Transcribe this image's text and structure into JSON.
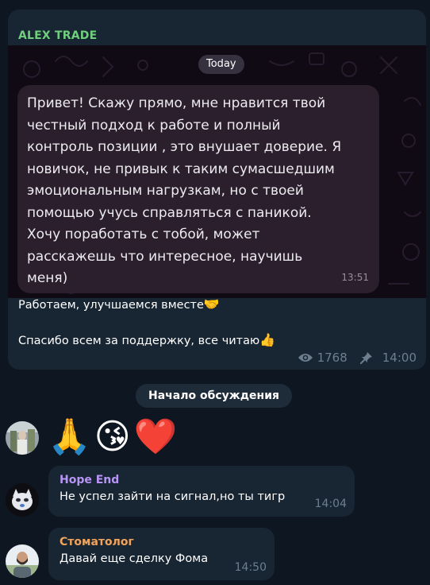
{
  "channel_post": {
    "author": "ALEX TRADE",
    "author_color": "#6fcf7c",
    "date_label": "Today",
    "quoted_message": {
      "text": "Привет! Скажу прямо, мне нравится твой\nчестный подход к работе и полный\nконтроль позиции , это внушает доверие. Я\nновичок, не привык к таким сумасшедшим\nэмоциональным нагрузкам, но с твоей\nпомощью учусь справляться с паникой.\nХочу поработать с тобой, может\nрасскажешь что интересное, научишь\nменя)",
      "time": "13:51"
    },
    "caption": {
      "line1": "Работаем, улучшаемся вместе",
      "line1_emoji": "🤝",
      "line2": "Спасибо всем за поддержку, все читаю",
      "line2_emoji": "👍"
    },
    "views": "1768",
    "views_icon": "eye-icon",
    "pin_icon": "pin-icon",
    "time": "14:00"
  },
  "discussion_label": "Начало обсуждения",
  "messages": [
    {
      "type": "emoji",
      "emojis": [
        "🙏",
        "😘",
        "❤️"
      ]
    },
    {
      "type": "text",
      "author": "Hope End",
      "author_color": "#b794f6",
      "text": "Не успел зайти на сигнал,но ты тигр",
      "time": "14:04"
    },
    {
      "type": "text",
      "author": "Стоматолог",
      "author_color": "#f0a35a",
      "text": "Давай еще сделку Фома",
      "time": "14:50"
    }
  ],
  "colors": {
    "background": "#0e1621",
    "bubble": "#182533",
    "meta": "#6d7f8f"
  }
}
